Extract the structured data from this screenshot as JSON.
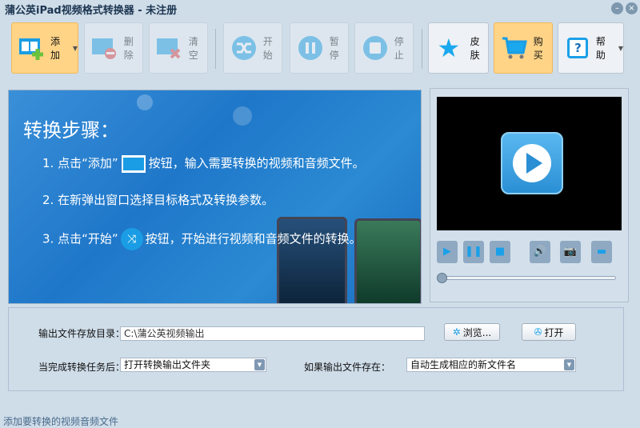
{
  "window": {
    "title": "蒲公英iPad视频格式转换器 - 未注册",
    "minimize": "–",
    "close": "×"
  },
  "toolbar": {
    "add": "添加",
    "delete": "删除",
    "clear": "清空",
    "start": "开始",
    "pause": "暂停",
    "stop": "停止",
    "skin": "皮肤",
    "buy": "购买",
    "help": "帮助"
  },
  "banner": {
    "heading": "转换步骤：",
    "step1a": "1. 点击“添加”",
    "step1b": "按钮，输入需要转换的视频和音频文件。",
    "step2": "2. 在新弹出窗口选择目标格式及转换参数。",
    "step3a": "3. 点击“开始”",
    "step3b": "按钮，开始进行视频和音频文件的转换。"
  },
  "player": {
    "progress": 0
  },
  "settings": {
    "output_dir_label": "输出文件存放目录：",
    "output_dir_value": "C:\\蒲公英视频输出",
    "browse": "浏览...",
    "open": "打开",
    "after_label": "当完成转换任务后：",
    "after_value": "打开转换输出文件夹",
    "exists_label": "如果输出文件存在：",
    "exists_value": "自动生成相应的新文件名"
  },
  "status": {
    "text": "添加要转换的视频音频文件"
  },
  "colors": {
    "accent": "#1aa0e8",
    "highlight": "#ffd487"
  }
}
